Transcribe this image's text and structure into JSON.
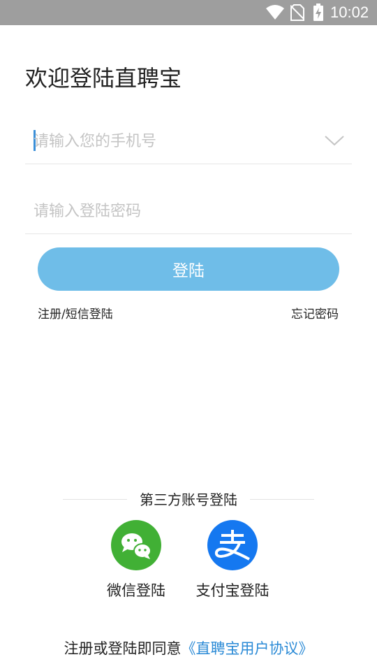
{
  "status_bar": {
    "time": "10:02",
    "icons": [
      "wifi-icon",
      "no-sim-icon",
      "battery-charging-icon"
    ]
  },
  "title": "欢迎登陆直聘宝",
  "phone_field": {
    "placeholder": "请输入您的手机号",
    "value": ""
  },
  "password_field": {
    "placeholder": "请输入登陆密码",
    "value": ""
  },
  "login_button": "登陆",
  "register_link": "注册/短信登陆",
  "forgot_link": "忘记密码",
  "third_party": {
    "label": "第三方账号登陆",
    "options": [
      {
        "name": "微信登陆",
        "icon": "wechat-icon",
        "color": "#41b035"
      },
      {
        "name": "支付宝登陆",
        "icon": "alipay-icon",
        "color": "#1578f0"
      }
    ]
  },
  "agreement": {
    "prefix": "注册或登陆即同意",
    "link": "《直聘宝用户协议》"
  },
  "colors": {
    "accent": "#2a8ad6",
    "button": "#6fbde8",
    "status_bar": "#9e9e9e"
  }
}
